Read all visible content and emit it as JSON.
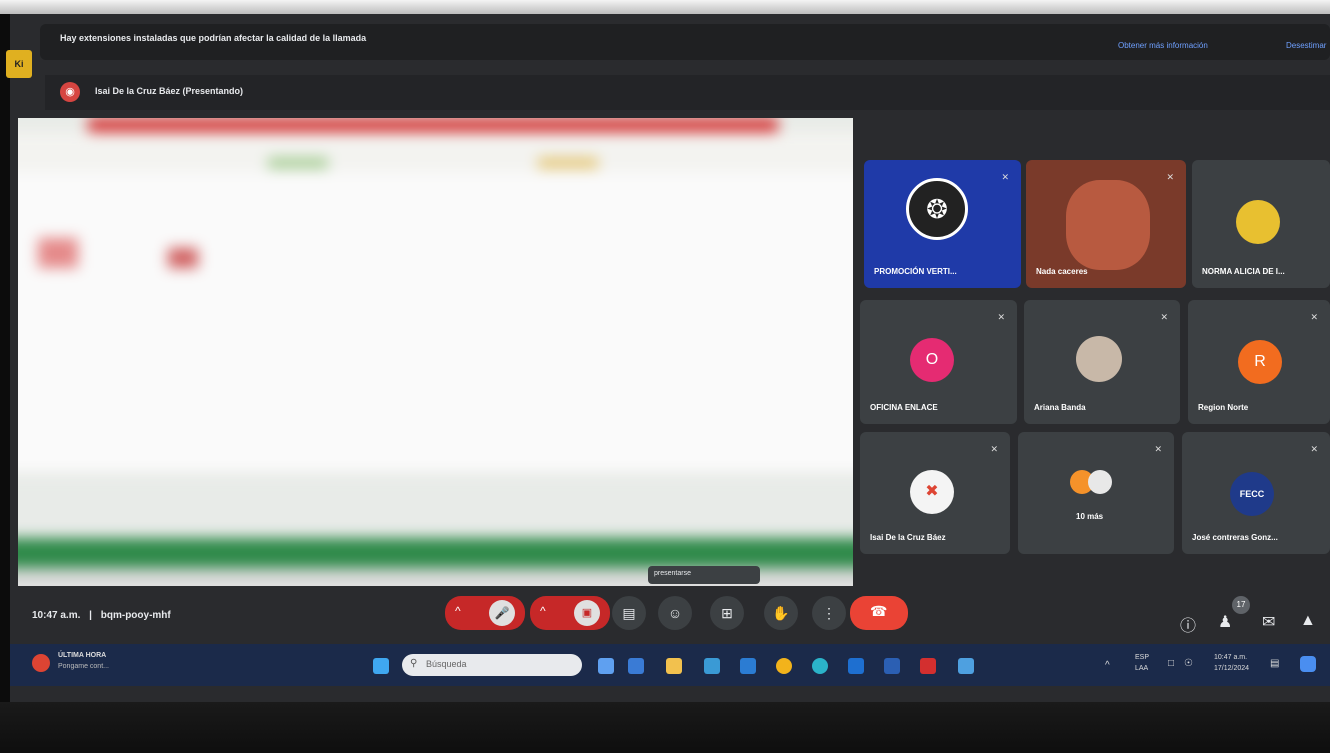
{
  "banner": {
    "text": "Hay extensiones instaladas que podrían afectar la calidad de la llamada",
    "more_link": "Obtener más información",
    "dismiss_link": "Desestimar",
    "tag": "Ki"
  },
  "presenter_bar": {
    "label": "Isai De la Cruz Báez (Presentando)"
  },
  "presentation": {
    "tooltip": "presentarse"
  },
  "participants": [
    {
      "name": "PROMOCIÓN VERTI...",
      "initial": ""
    },
    {
      "name": "Nada caceres",
      "initial": ""
    },
    {
      "name": "NORMA ALICIA DE I...",
      "initial": ""
    },
    {
      "name": "OFICINA ENLACE",
      "initial": "O"
    },
    {
      "name": "Ariana Banda",
      "initial": ""
    },
    {
      "name": "Region Norte",
      "initial": "R"
    },
    {
      "name": "Isai De la Cruz Báez",
      "initial": ""
    },
    {
      "name": "10 más",
      "initial": ""
    },
    {
      "name": "José contreras Gonz...",
      "initial": ""
    }
  ],
  "meeting": {
    "time": "10:47 a.m.",
    "code": "bqm-pooy-mhf",
    "separator": "|",
    "participants_count": "17"
  },
  "taskbar": {
    "weather_title": "ÚLTIMA HORA",
    "weather_sub": "Pongame cont...",
    "search_placeholder": "Búsqueda",
    "lang_top": "ESP",
    "lang_bottom": "LAA",
    "clock_time": "10:47 a.m.",
    "clock_date": "17/12/2024"
  },
  "colors": {
    "end_call": "#ea4335",
    "accent_link": "#6fa0ff",
    "tile_bg": "#3c4043"
  }
}
